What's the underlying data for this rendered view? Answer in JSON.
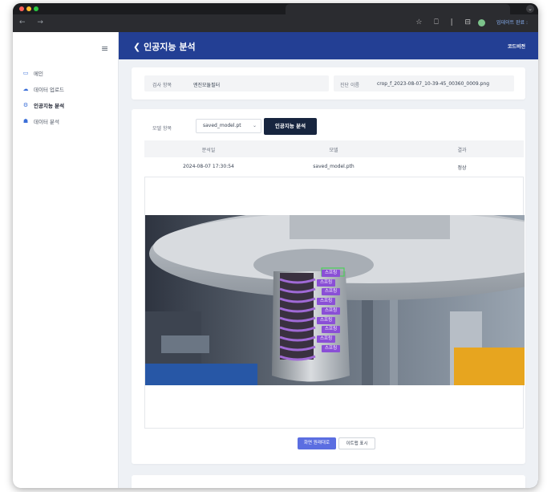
{
  "browser": {
    "update_label": "업데이트 완료 :",
    "menu_icons": [
      "star-icon",
      "extension-icon",
      "sidebar-icon"
    ]
  },
  "sidebar": {
    "items": [
      {
        "label": "메인",
        "icon": "monitor-icon"
      },
      {
        "label": "데이터 업로드",
        "icon": "cloud-upload-icon"
      },
      {
        "label": "인공지능 분석",
        "icon": "gear-icon"
      },
      {
        "label": "데이터 분석",
        "icon": "people-icon"
      }
    ],
    "active_index": 2
  },
  "header": {
    "title": "인공지능 분석",
    "back_icon": "chevron-left-icon",
    "company": "코드비전"
  },
  "info": {
    "inspection_label": "검사 항목",
    "inspection_value": "엔진모듈필터",
    "file_label": "진단 이름",
    "file_value": "crop_f_2023-08-07_10-39-45_00360_0009.png"
  },
  "analysis": {
    "model_label": "모델 항목",
    "model_selected": "saved_model.pt",
    "run_button": "인공지능 분석",
    "columns": [
      "분석일",
      "모델",
      "결과"
    ],
    "rows": [
      {
        "date": "2024-08-07 17:30:54",
        "model": "saved_model.pth",
        "result": "정상"
      }
    ],
    "detections": [
      "스프링",
      "스프링",
      "스프링",
      "스프링",
      "스프링",
      "스프링",
      "스프링",
      "스프링",
      "스프링"
    ],
    "view_buttons": [
      "화면 원래대로",
      "이트맵 표시"
    ]
  },
  "colors": {
    "header_bg": "#233f94",
    "label_purple": "#8a4fd6",
    "run_button": "#17253f",
    "active_view_button": "#5b6ee1"
  }
}
